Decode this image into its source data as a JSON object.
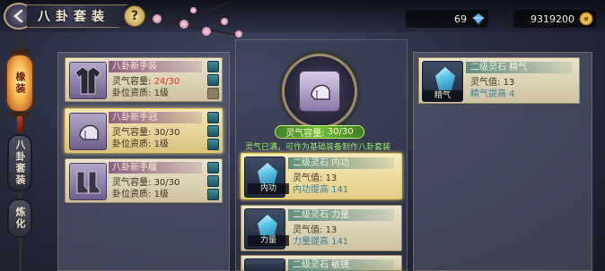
{
  "header": {
    "title": "八卦套装",
    "help": "?"
  },
  "currencies": [
    {
      "value": "69",
      "icon": "blue-gem-icon"
    },
    {
      "value": "9319200",
      "icon": "copper-coin-icon"
    }
  ],
  "side_tabs": [
    {
      "label": "橡装",
      "active": true
    },
    {
      "label": "八卦套装",
      "active": false
    },
    {
      "label": "炼化",
      "active": false
    }
  ],
  "equipment": [
    {
      "name": "八卦新手装",
      "capacity_label": "灵气容量:",
      "capacity_value": "24/30",
      "capacity_full": false,
      "rank_label": "卦位资质:",
      "rank_value": "1级",
      "slots": [
        "filled",
        "filled",
        "filled",
        "empty"
      ],
      "icon": "robe-icon",
      "selected": false
    },
    {
      "name": "八卦新手冠",
      "capacity_label": "灵气容量:",
      "capacity_value": "30/30",
      "capacity_full": true,
      "rank_label": "卦位资质:",
      "rank_value": "1级",
      "slots": [
        "filled",
        "filled",
        "filled"
      ],
      "icon": "helmet-icon",
      "selected": true
    },
    {
      "name": "八卦新手履",
      "capacity_label": "灵气容量:",
      "capacity_value": "30/30",
      "capacity_full": true,
      "rank_label": "卦位资质:",
      "rank_value": "1级",
      "slots": [
        "filled",
        "filled",
        "filled"
      ],
      "icon": "boots-icon",
      "selected": false
    }
  ],
  "center": {
    "capacity_label": "灵气容量:",
    "capacity_value": "30/30",
    "notice": "灵气已满，可作为基础装备制作八卦套装"
  },
  "stones": [
    {
      "name": "二级灵石  内功",
      "tag": "内功",
      "lingqi_label": "灵气值:",
      "lingqi_value": "13",
      "bonus": "内功提高  141",
      "highlight": true
    },
    {
      "name": "二级灵石  力量",
      "tag": "力量",
      "lingqi_label": "灵气值:",
      "lingqi_value": "13",
      "bonus": "力量提高  141",
      "highlight": false
    },
    {
      "name": "二级灵石  敏捷",
      "tag": "",
      "lingqi_label": "",
      "lingqi_value": "",
      "bonus": "",
      "highlight": false
    }
  ],
  "right_stone": {
    "name": "二级灵石  精气",
    "tag": "精气",
    "lingqi_label": "灵气值:",
    "lingqi_value": "13",
    "bonus": "精气提高  4"
  }
}
